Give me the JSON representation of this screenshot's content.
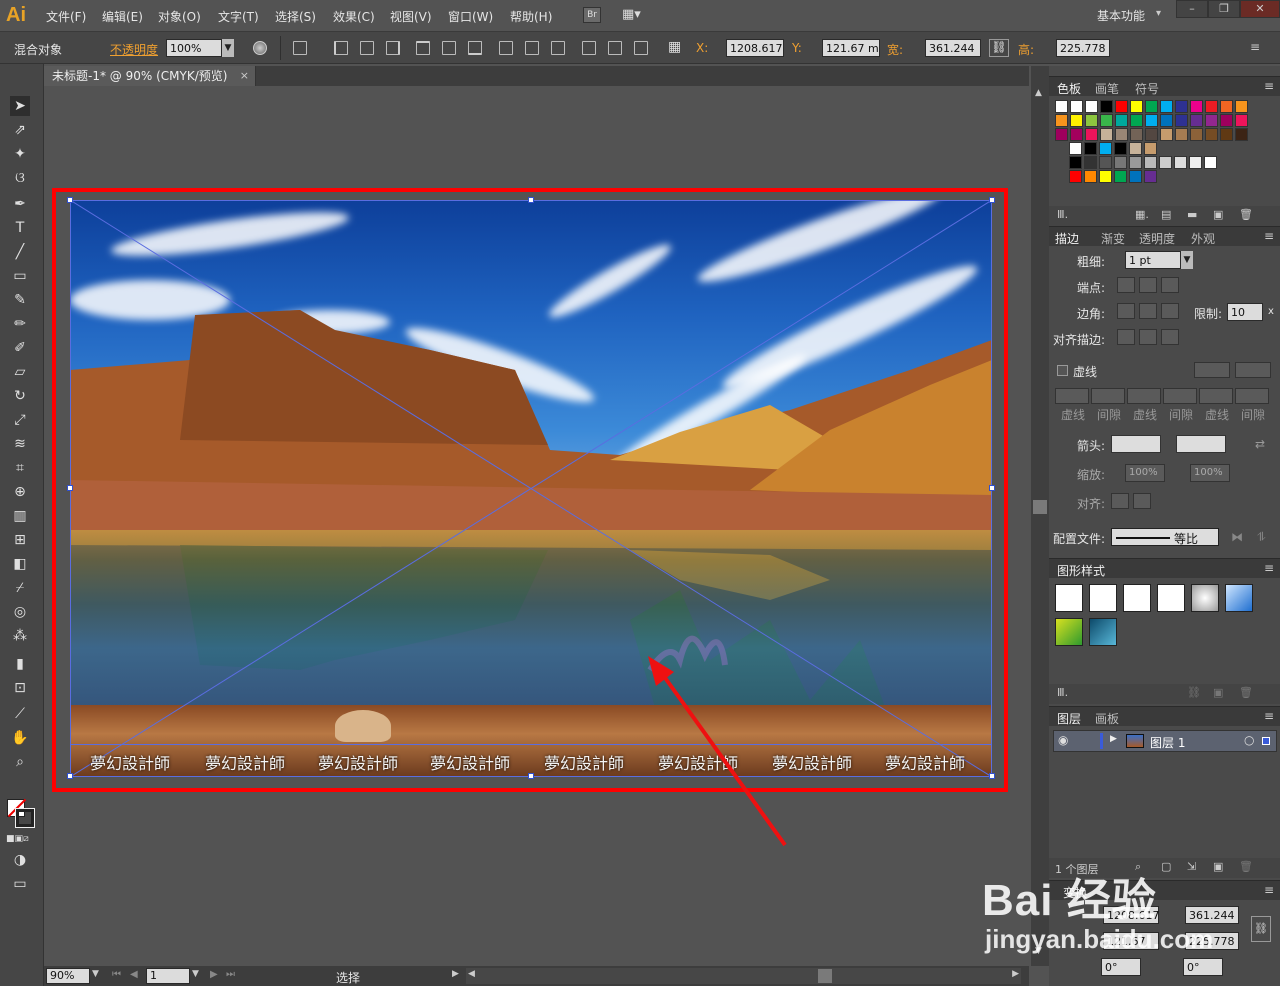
{
  "app": {
    "logo": "Ai",
    "workspace": "基本功能"
  },
  "menus": [
    "文件(F)",
    "编辑(E)",
    "对象(O)",
    "文字(T)",
    "选择(S)",
    "效果(C)",
    "视图(V)",
    "窗口(W)",
    "帮助(H)"
  ],
  "bridge_button": "Br",
  "control_bar": {
    "selection": "混合对象",
    "opacity_label": "不透明度",
    "opacity_value": "100%",
    "x_label": "X:",
    "x_value": "1208.617",
    "y_label": "Y:",
    "y_value": "121.67 m",
    "w_label": "宽:",
    "w_value": "361.244",
    "h_label": "高:",
    "h_value": "225.778"
  },
  "document_tab": "未标题-1* @ 90% (CMYK/预览)",
  "watermark_text": "夢幻設計師",
  "watermark_repeat": 8,
  "panels": {
    "swatches_tabs": [
      "色板",
      "画笔",
      "符号"
    ],
    "stroke_tabs": [
      "描边",
      "渐变",
      "透明度",
      "外观"
    ],
    "stroke": {
      "weight_label": "粗细:",
      "weight_value": "1 pt",
      "cap_label": "端点:",
      "corner_label": "边角:",
      "limit_label": "限制:",
      "limit_value": "10",
      "limit_unit": "x",
      "align_label": "对齐描边:",
      "dashed_label": "虚线",
      "dash_labels": [
        "虚线",
        "间隙",
        "虚线",
        "间隙",
        "虚线",
        "间隙"
      ],
      "arrow_label": "箭头:",
      "scale_label": "缩放:",
      "scale_1": "100%",
      "scale_2": "100%",
      "align_arrow_label": "对齐:",
      "profile_label": "配置文件:",
      "profile_value": "等比"
    },
    "graphic_styles_tab": "图形样式",
    "layers_tabs": [
      "图层",
      "画板"
    ],
    "layer_name": "图层 1",
    "layer_count": "1 个图层",
    "transform": {
      "tab": "变换",
      "x": "1208.617",
      "w": "361.244",
      "y": "121.67",
      "h": "225.778",
      "rot": "0°",
      "shear": "0°"
    }
  },
  "status": {
    "zoom": "90%",
    "page": "1",
    "mode": "选择"
  },
  "overlay": {
    "brand": "Bai 经验",
    "url": "jingyan.baidu.com"
  },
  "colors": {
    "highlight_frame": "#ff0000",
    "arrow": "#ee1111",
    "selection": "#3a5bd9"
  }
}
